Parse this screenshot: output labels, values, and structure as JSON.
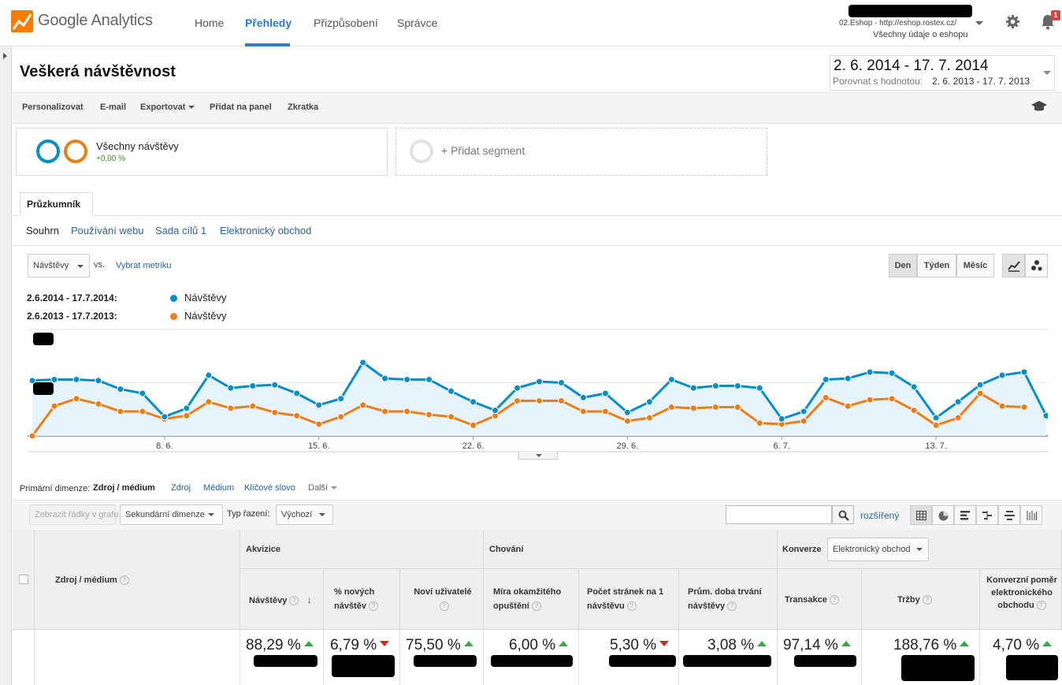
{
  "header": {
    "brand": "Google Analytics",
    "nav": [
      "Home",
      "Přehledy",
      "Přizpůsobení",
      "Správce"
    ],
    "active_nav": "Přehledy",
    "account_line": "02.Eshop - http://eshop.rostex.cz/",
    "account_view": "Všechny údaje o eshopu",
    "notifications_count": "1",
    "brand_color": "#f57c00",
    "accent_color": "#2b7bd3"
  },
  "report": {
    "title": "Veškerá návštěvnost",
    "date_range": "2. 6. 2014 - 17. 7. 2014",
    "compare_label": "Porovnat s hodnotou:",
    "compare_range": "2. 6. 2013 - 17. 7. 2013"
  },
  "actions": {
    "personalize": "Personalizovat",
    "email": "E-mail",
    "export": "Exportovat",
    "add_dashboard": "Přidat na panel",
    "shortcut": "Zkratka"
  },
  "segments": {
    "active_name": "Všechny návštěvy",
    "active_change": "+0,00 %",
    "add_label": "+ Přidat segment"
  },
  "tabs": {
    "explorer": "Průzkumník",
    "subtabs": [
      "Souhrn",
      "Používání webu",
      "Sada cílů 1",
      "Elektronický obchod"
    ]
  },
  "chart_controls": {
    "metric": "Návštěvy",
    "vs": "vs.",
    "pick_metric": "Vybrat metriku",
    "periods": [
      "Den",
      "Týden",
      "Měsíc"
    ],
    "active_period": "Den"
  },
  "legend": [
    {
      "range": "2.6.2014 - 17.7.2014:",
      "name": "Návštěvy",
      "color": "#058dc7"
    },
    {
      "range": "2.6.2013 - 17.7.2013:",
      "name": "Návštěvy",
      "color": "#ed7e17"
    }
  ],
  "chart_data": {
    "type": "line",
    "x_tick_labels": [
      "8. 6.",
      "15. 6.",
      "22. 6.",
      "29. 6.",
      "6. 7.",
      "13. 7."
    ],
    "ylim": [
      0,
      100
    ],
    "grid": true,
    "series": [
      {
        "name": "Návštěvy",
        "color": "#058dc7",
        "values": [
          52,
          53,
          53,
          52,
          44,
          40,
          18,
          26,
          57,
          45,
          47,
          48,
          40,
          29,
          35,
          69,
          54,
          53,
          53,
          42,
          32,
          24,
          45,
          51,
          50,
          36,
          40,
          22,
          32,
          53,
          45,
          47,
          47,
          45,
          16,
          23,
          53,
          54,
          60,
          59,
          46,
          17,
          32,
          48,
          57,
          60,
          19
        ]
      },
      {
        "name": "Návštěvy",
        "color": "#ed7e17",
        "values": [
          0,
          28,
          35,
          30,
          23,
          23,
          16,
          19,
          32,
          26,
          28,
          22,
          19,
          11,
          18,
          29,
          23,
          23,
          20,
          18,
          10,
          19,
          33,
          33,
          33,
          23,
          23,
          14,
          17,
          27,
          26,
          27,
          27,
          12,
          11,
          14,
          36,
          28,
          34,
          35,
          24,
          10,
          17,
          40,
          28,
          27
        ]
      }
    ]
  },
  "dimensions": {
    "label": "Primární dimenze:",
    "active": "Zdroj / médium",
    "options": [
      "Zdroj",
      "Médium",
      "Klíčové slovo",
      "Další"
    ]
  },
  "table_toolbar": {
    "plot_rows": "Zobrazit řádky v grafu",
    "secondary_dim": "Sekundární dimenze",
    "sort_label": "Typ řazení:",
    "sort_value": "Výchozí",
    "advanced": "rozšířený"
  },
  "table": {
    "dim_header": "Zdroj / médium",
    "groups": {
      "acquisition": "Akvizice",
      "behavior": "Chování",
      "conversions": "Konverze"
    },
    "conv_select": "Elektronický obchod",
    "columns": [
      {
        "label": "Návštěvy",
        "value": "88,29 %",
        "trend": "up"
      },
      {
        "label": "% nových návštěv",
        "value": "6,79 %",
        "trend": "down"
      },
      {
        "label": "Noví uživatelé",
        "value": "75,50 %",
        "trend": "up"
      },
      {
        "label": "Míra okamžitého opuštění",
        "value": "6,00 %",
        "trend": "up"
      },
      {
        "label": "Počet stránek na 1 návštěvu",
        "value": "5,30 %",
        "trend": "down"
      },
      {
        "label": "Prům. doba trvání návštěvy",
        "value": "3,08 %",
        "trend": "up"
      },
      {
        "label": "Transakce",
        "value": "97,14 %",
        "trend": "up"
      },
      {
        "label": "Tržby",
        "value": "188,76 %",
        "trend": "up"
      },
      {
        "label": "Konverzní poměr elektronického obchodu",
        "value": "4,70 %",
        "trend": "up"
      }
    ]
  }
}
